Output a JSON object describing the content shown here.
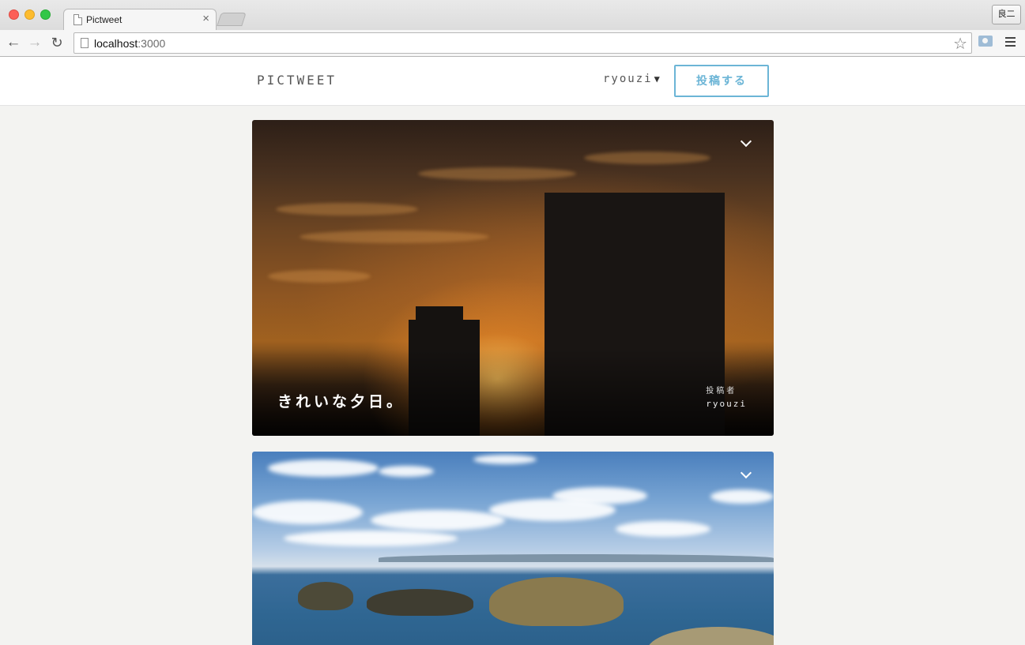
{
  "browser": {
    "tab_title": "Pictweet",
    "tab_close": "×",
    "profile_label": "良二",
    "url_host": "localhost",
    "url_port": ":3000"
  },
  "site": {
    "logo": "PICTWEET",
    "user_name": "ryouzi",
    "user_caret": "▼",
    "post_button_label": "投稿する"
  },
  "tweets": [
    {
      "caption": "きれいな夕日。",
      "author_label": "投稿者",
      "author_name": "ryouzi"
    },
    {
      "caption": "",
      "author_label": "",
      "author_name": ""
    }
  ],
  "colors": {
    "accent": "#6cb5d6",
    "page_bg": "#f3f3f1"
  }
}
